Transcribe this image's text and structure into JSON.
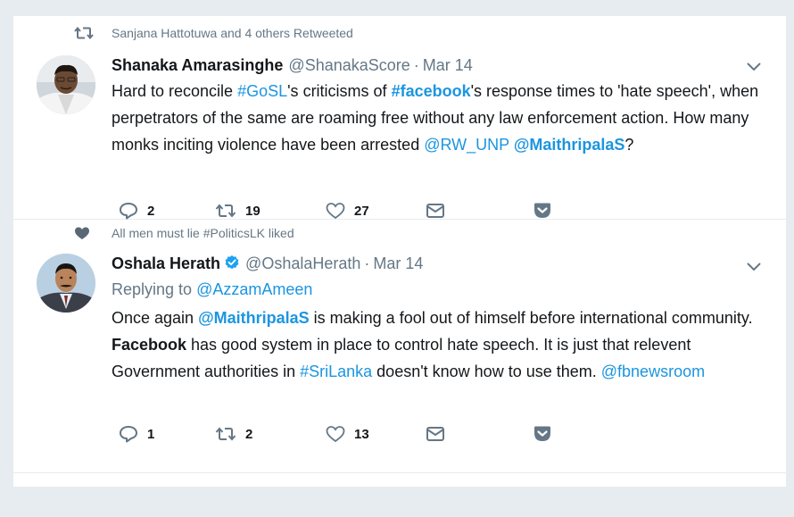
{
  "tweets": [
    {
      "context": "Sanjana Hattotuwa and 4 others Retweeted",
      "context_type": "retweet",
      "fullname": "Shanaka Amarasinghe",
      "username": "@ShanakaScore",
      "dot": "·",
      "time": "Mar 14",
      "text_parts": {
        "p1": "Hard to reconcile ",
        "tag1": "#GoSL",
        "p2": "'s criticisms of ",
        "tag2": "#facebook",
        "p3": "'s response times to 'hate speech', when perpetrators of the same are roaming free without any law enforcement action. How many monks inciting violence have been arrested ",
        "mention1": "@RW_UNP",
        "p4": " ",
        "mention2": "@MaithripalaS",
        "p5": "?"
      },
      "replies": "2",
      "retweets": "19",
      "likes": "27"
    },
    {
      "context": "All men must lie #PoliticsLK liked",
      "context_type": "like",
      "fullname": "Oshala Herath",
      "verified": true,
      "username": "@OshalaHerath",
      "dot": "·",
      "time": "Mar 14",
      "replying_label": "Replying to ",
      "replying_to": "@AzzamAmeen",
      "text_parts": {
        "p1": "Once again ",
        "mention1": "@MaithripalaS",
        "p2": " is making a fool out of himself before international community. ",
        "bold1": "Facebook",
        "p3": " has good system in place to control hate speech. It is just that relevent Government authorities in ",
        "tag1": "#SriLanka",
        "p4": " doesn't know how to use them. ",
        "mention2": "@fbnewsroom"
      },
      "replies": "1",
      "retweets": "2",
      "likes": "13"
    }
  ],
  "colors": {
    "link": "#1b95e0",
    "muted": "#657786",
    "verified": "#1da1f2",
    "background": "#e6ecf0"
  },
  "icons": [
    "retweet-icon",
    "heart-icon",
    "reply-icon",
    "like-icon",
    "envelope-icon",
    "pocket-icon",
    "chevron-down-icon",
    "verified-badge-icon"
  ]
}
